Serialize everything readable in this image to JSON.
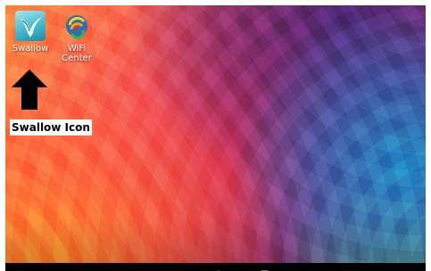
{
  "desktop": {
    "apps": [
      {
        "label": "Swallow",
        "icon": "swallow-icon"
      },
      {
        "label": "WiFi\nCenter",
        "label_line1": "WiFi",
        "label_line2": "Center",
        "icon": "wifi-center-icon"
      }
    ]
  },
  "annotation": {
    "callout_text": "Swallow Icon",
    "arrow_icon": "up-arrow-icon"
  },
  "navbar": {
    "buttons": [
      "back-icon",
      "home-icon",
      "recent-apps-icon",
      "menu-icon"
    ]
  },
  "colors": {
    "nav_bg": "#000000",
    "callout_bg": "#ffffff",
    "callout_text": "#000000"
  }
}
